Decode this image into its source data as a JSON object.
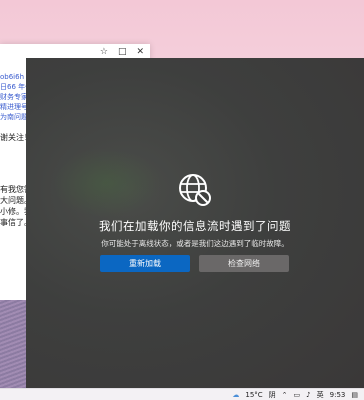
{
  "background_window": {
    "pin_icon": "pin-icon",
    "maximize_icon": "maximize-icon",
    "close_icon": "close-icon",
    "snippet_lines": [
      "ob6i6h",
      "日66 年代",
      "财务专家",
      "精进理号",
      "为南问题"
    ],
    "follow_text": "谢关注！",
    "body_lines": [
      "有我您需要",
      "大问题。请",
      "小修。我们给",
      "事信了。"
    ]
  },
  "error_page": {
    "icon": "globe-blocked-icon",
    "title": "我们在加载你的信息流时遇到了问题",
    "subtitle": "你可能处于离线状态，或者是我们这边遇到了临时故障。",
    "retry_button": "重新加载",
    "check_network_button": "检查网络"
  },
  "taskbar": {
    "weather_icon": "cloud-icon",
    "temperature": "15°C",
    "weather": "阴",
    "tray_icons": [
      "chevron-up-icon",
      "network-icon",
      "volume-icon"
    ],
    "input_method": "英",
    "time": "9:53",
    "notification_icon": "notification-icon"
  }
}
